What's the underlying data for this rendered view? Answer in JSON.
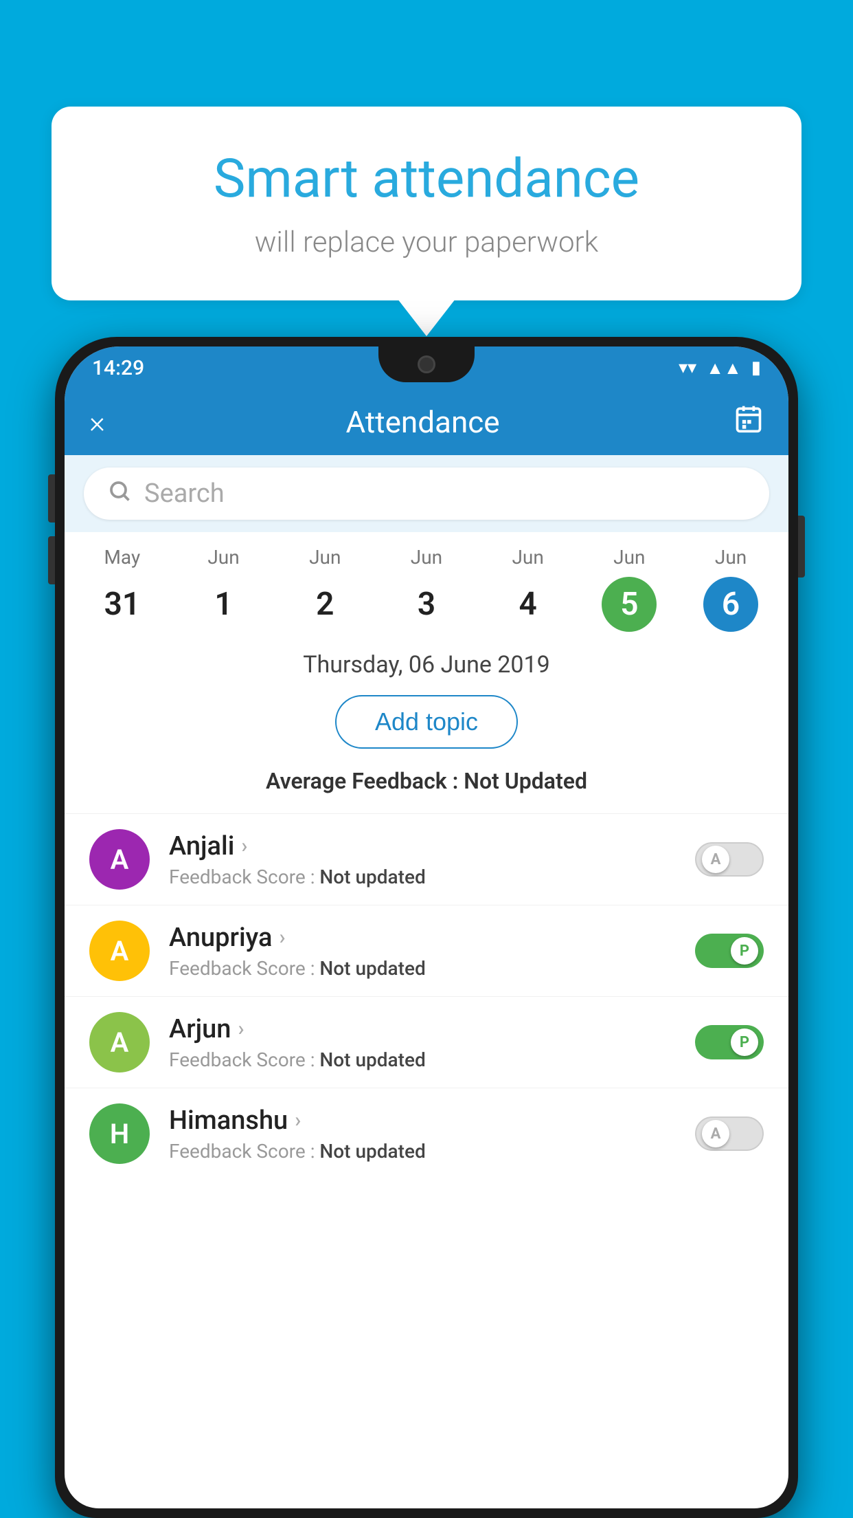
{
  "background_color": "#00AADD",
  "speech_bubble": {
    "title": "Smart attendance",
    "subtitle": "will replace your paperwork"
  },
  "status_bar": {
    "time": "14:29"
  },
  "app_bar": {
    "title": "Attendance",
    "close_label": "×",
    "calendar_label": "📅"
  },
  "search": {
    "placeholder": "Search"
  },
  "calendar": {
    "dates": [
      {
        "month": "May",
        "day": "31",
        "state": "normal"
      },
      {
        "month": "Jun",
        "day": "1",
        "state": "normal"
      },
      {
        "month": "Jun",
        "day": "2",
        "state": "normal"
      },
      {
        "month": "Jun",
        "day": "3",
        "state": "normal"
      },
      {
        "month": "Jun",
        "day": "4",
        "state": "normal"
      },
      {
        "month": "Jun",
        "day": "5",
        "state": "today"
      },
      {
        "month": "Jun",
        "day": "6",
        "state": "selected"
      }
    ]
  },
  "selected_date": "Thursday, 06 June 2019",
  "add_topic_label": "Add topic",
  "avg_feedback_label": "Average Feedback :",
  "avg_feedback_value": "Not Updated",
  "students": [
    {
      "name": "Anjali",
      "avatar_letter": "A",
      "avatar_color": "avatar-purple",
      "feedback_label": "Feedback Score :",
      "feedback_value": "Not updated",
      "toggle_state": "off",
      "toggle_letter": "A"
    },
    {
      "name": "Anupriya",
      "avatar_letter": "A",
      "avatar_color": "avatar-yellow",
      "feedback_label": "Feedback Score :",
      "feedback_value": "Not updated",
      "toggle_state": "on",
      "toggle_letter": "P"
    },
    {
      "name": "Arjun",
      "avatar_letter": "A",
      "avatar_color": "avatar-green",
      "feedback_label": "Feedback Score :",
      "feedback_value": "Not updated",
      "toggle_state": "on",
      "toggle_letter": "P"
    },
    {
      "name": "Himanshu",
      "avatar_letter": "H",
      "avatar_color": "avatar-teal",
      "feedback_label": "Feedback Score :",
      "feedback_value": "Not updated",
      "toggle_state": "off",
      "toggle_letter": "A"
    }
  ]
}
